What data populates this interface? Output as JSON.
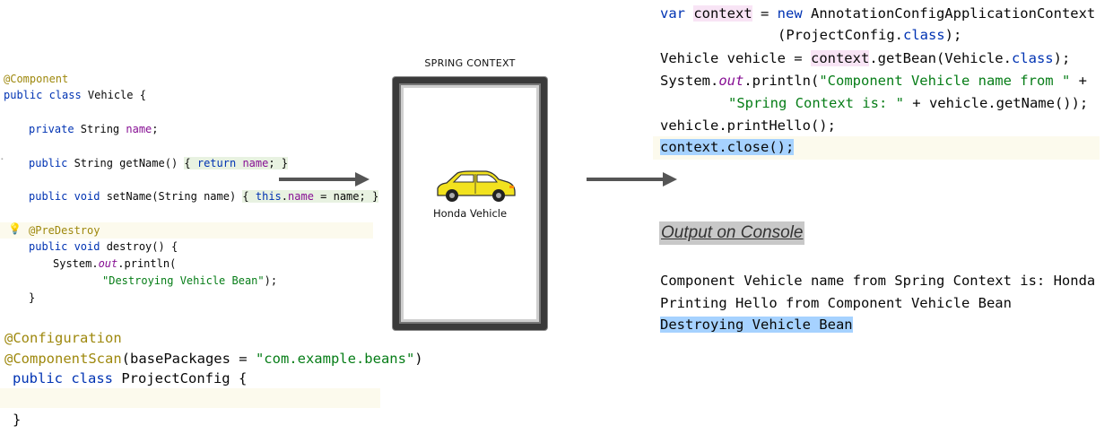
{
  "left_code": {
    "component_class": [
      "@Component",
      "public class Vehicle {",
      "private String name;",
      "public String getName() { return name; }",
      "public void setName(String name) { this.name = name; }",
      "@PreDestroy",
      "public void destroy() {",
      "System.out.println(",
      "\"Destroying Vehicle Bean\");",
      "}"
    ],
    "config_class": [
      "@Configuration",
      "@ComponentScan(basePackages = \"com.example.beans\")",
      "public class ProjectConfig {",
      "}"
    ]
  },
  "diagram": {
    "spring_context_title": "SPRING CONTEXT",
    "vehicle_label": "Honda Vehicle",
    "car_color": "#f2e21e"
  },
  "right_code": [
    "var context = new AnnotationConfigApplicationContext",
    "(ProjectConfig.class);",
    "Vehicle vehicle = context.getBean(Vehicle.class);",
    "System.out.println(\"Component Vehicle name from \" +",
    "\"Spring Context is: \" + vehicle.getName());",
    "vehicle.printHello();",
    "context.close();"
  ],
  "console": {
    "heading": "Output on Console",
    "lines": [
      "Component Vehicle name from Spring Context is: Honda",
      "Printing Hello from Component Vehicle Bean",
      "Destroying Vehicle Bean"
    ]
  },
  "colors": {
    "keyword": "#0033b3",
    "annotation": "#9e880d",
    "string": "#067d17",
    "field": "#871094",
    "selection": "#a6d2ff",
    "arrow": "#555555"
  }
}
